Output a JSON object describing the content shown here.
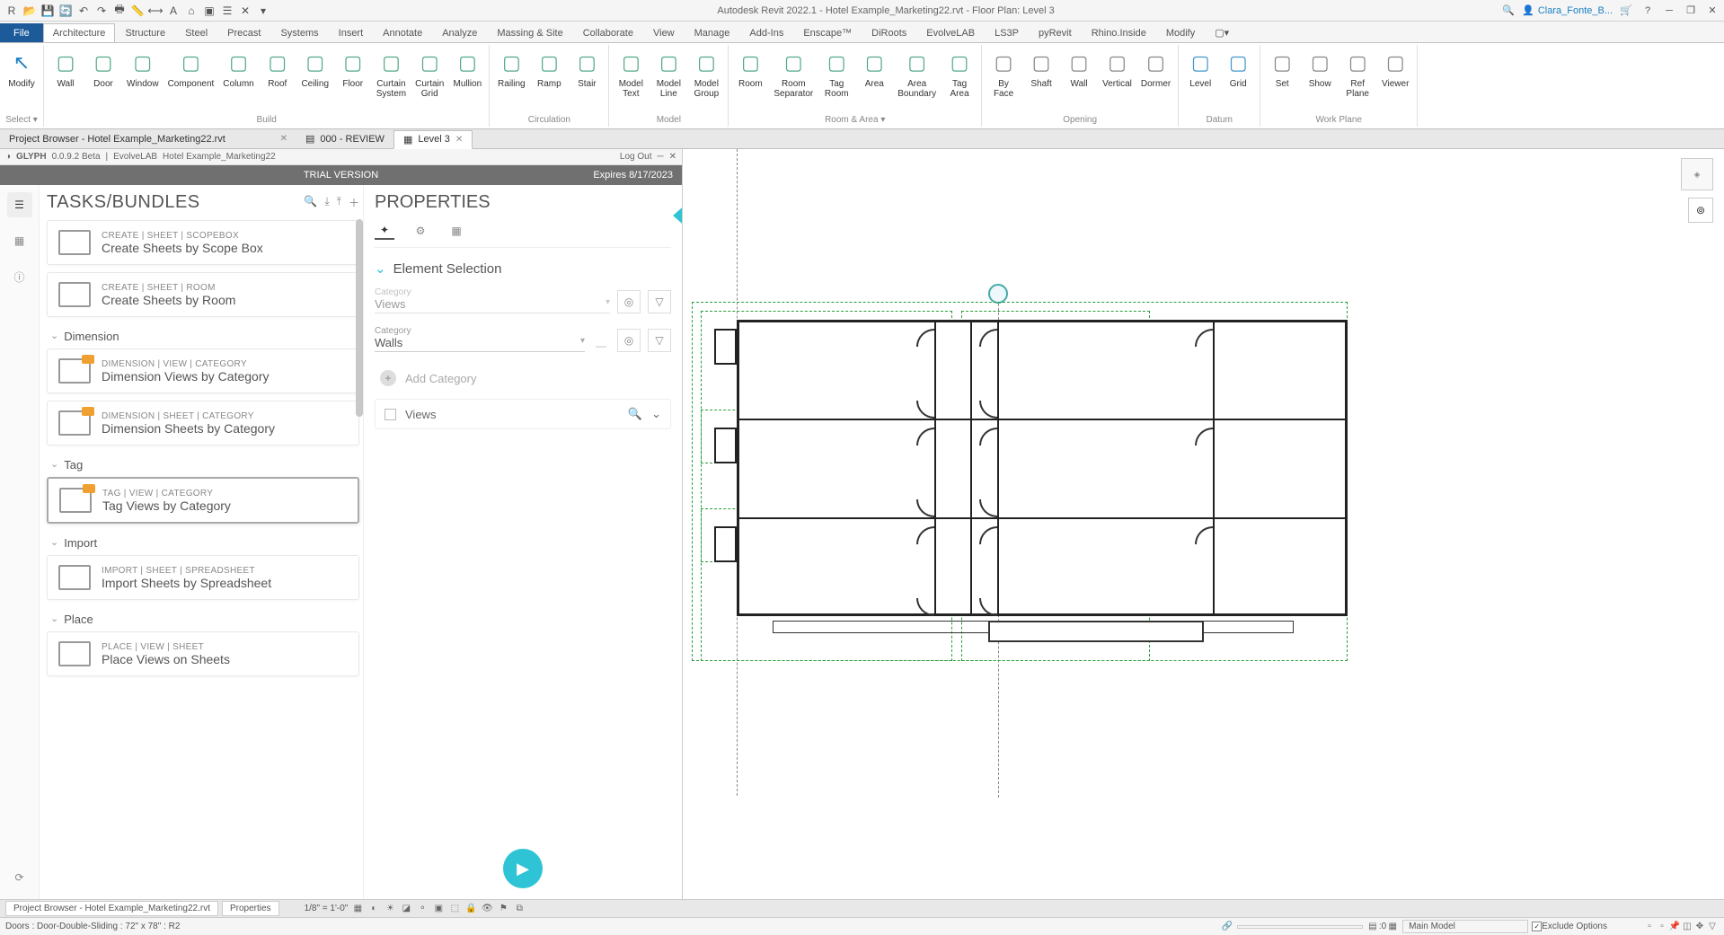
{
  "app_title": "Autodesk Revit 2022.1 - Hotel Example_Marketing22.rvt - Floor Plan: Level 3",
  "user": "Clara_Fonte_B...",
  "ribbon_tabs": [
    "File",
    "Architecture",
    "Structure",
    "Steel",
    "Precast",
    "Systems",
    "Insert",
    "Annotate",
    "Analyze",
    "Massing & Site",
    "Collaborate",
    "View",
    "Manage",
    "Add-Ins",
    "Enscape™",
    "DiRoots",
    "EvolveLAB",
    "LS3P",
    "pyRevit",
    "Rhino.Inside",
    "Modify"
  ],
  "ribbon": {
    "modify": "Modify",
    "select": "Select ▾",
    "build": {
      "label": "Build",
      "items": [
        "Wall",
        "Door",
        "Window",
        "Component",
        "Column",
        "Roof",
        "Ceiling",
        "Floor",
        "Curtain\nSystem",
        "Curtain\nGrid",
        "Mullion"
      ]
    },
    "circulation": {
      "label": "Circulation",
      "items": [
        "Railing",
        "Ramp",
        "Stair"
      ]
    },
    "model": {
      "label": "Model",
      "items": [
        "Model\nText",
        "Model\nLine",
        "Model\nGroup"
      ]
    },
    "room_area": {
      "label": "Room & Area ▾",
      "items": [
        "Room",
        "Room\nSeparator",
        "Tag\nRoom",
        "Area",
        "Area\nBoundary",
        "Tag\nArea"
      ]
    },
    "opening": {
      "label": "Opening",
      "items": [
        "By\nFace",
        "Shaft",
        "Wall",
        "Vertical",
        "Dormer"
      ]
    },
    "datum": {
      "label": "Datum",
      "items": [
        "Level",
        "Grid"
      ]
    },
    "workplane": {
      "label": "Work Plane",
      "items": [
        "Set",
        "Show",
        "Ref\nPlane",
        "Viewer"
      ]
    }
  },
  "view_tabs": {
    "project_browser": "Project Browser - Hotel Example_Marketing22.rvt",
    "review": "000 - REVIEW",
    "level3": "Level 3"
  },
  "glyph": {
    "product": "GLYPH",
    "version": "0.0.9.2 Beta",
    "vendor": "EvolveLAB",
    "file": "Hotel Example_Marketing22",
    "logout": "Log Out",
    "trial": "TRIAL VERSION",
    "expires": "Expires 8/17/2023"
  },
  "tasks": {
    "title": "TASKS/BUNDLES",
    "cards": [
      {
        "group": null,
        "crumb": "CREATE  |  SHEET  |  SCOPEBOX",
        "name": "Create Sheets by Scope Box"
      },
      {
        "group": null,
        "crumb": "CREATE  |  SHEET  |  ROOM",
        "name": "Create Sheets by Room"
      },
      {
        "group": "Dimension",
        "crumb": "DIMENSION  |  VIEW  |  CATEGORY",
        "name": "Dimension Views by Category"
      },
      {
        "group": null,
        "crumb": "DIMENSION  |  SHEET  |  CATEGORY",
        "name": "Dimension Sheets by Category"
      },
      {
        "group": "Tag",
        "crumb": "TAG  |  VIEW  |  CATEGORY",
        "name": "Tag Views by Category",
        "selected": true
      },
      {
        "group": "Import",
        "crumb": "IMPORT  |  SHEET  |  SPREADSHEET",
        "name": "Import Sheets by Spreadsheet"
      },
      {
        "group": "Place",
        "crumb": "PLACE  |  VIEW  |  SHEET",
        "name": "Place Views on Sheets"
      }
    ]
  },
  "props": {
    "title": "PROPERTIES",
    "section": "Element Selection",
    "cat1_label": "Category",
    "cat1_value": "Views",
    "cat2_label": "Category",
    "cat2_value": "Walls",
    "add_cat": "Add Category",
    "views": "Views"
  },
  "status": {
    "project_browser_tab": "Project Browser - Hotel Example_Marketing22.rvt",
    "properties_tab": "Properties",
    "scale": "1/8\" = 1'-0\"",
    "selection_info": "Doors : Door-Double-Sliding : 72\" x 78\" : R2",
    "zero": ":0",
    "main_model": "Main Model",
    "exclude": "Exclude Options"
  }
}
